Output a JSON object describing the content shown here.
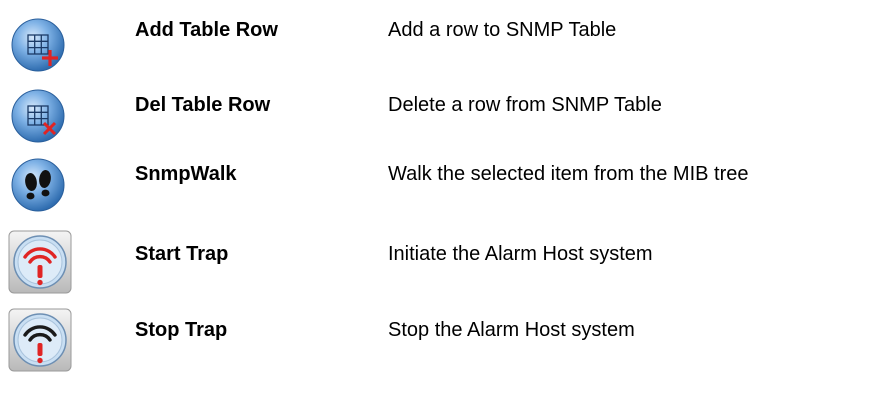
{
  "commands": [
    {
      "name": "Add Table Row",
      "description": "Add a row to SNMP Table",
      "icon": "add-table-row-icon"
    },
    {
      "name": "Del Table Row",
      "description": "Delete a row from SNMP Table",
      "icon": "delete-table-row-icon"
    },
    {
      "name": "SnmpWalk",
      "description": "Walk the selected item from the MIB tree",
      "icon": "footprints-icon"
    },
    {
      "name": "Start Trap",
      "description": "Initiate the Alarm Host system",
      "icon": "start-trap-icon"
    },
    {
      "name": "Stop Trap",
      "description": "Stop the Alarm Host system",
      "icon": "stop-trap-icon"
    }
  ],
  "colors": {
    "icon_blue": "#3a7cc4",
    "icon_red": "#e02424",
    "icon_dark": "#1a1a1a"
  }
}
